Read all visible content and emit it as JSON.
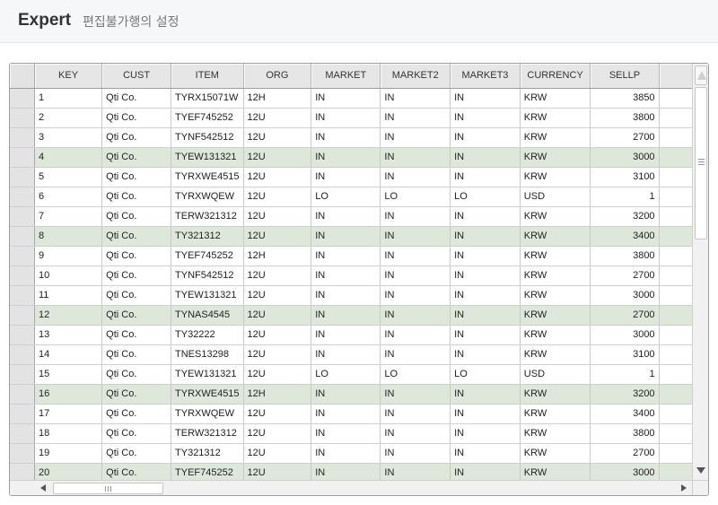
{
  "header": {
    "title": "Expert",
    "subtitle": "편집불가행의 설정"
  },
  "grid": {
    "columns": [
      {
        "key": "KEY",
        "label": "KEY"
      },
      {
        "key": "CUST",
        "label": "CUST"
      },
      {
        "key": "ITEM",
        "label": "ITEM"
      },
      {
        "key": "ORG",
        "label": "ORG"
      },
      {
        "key": "MARKET",
        "label": "MARKET"
      },
      {
        "key": "MARKET2",
        "label": "MARKET2"
      },
      {
        "key": "MARKET3",
        "label": "MARKET3"
      },
      {
        "key": "CURRENCY",
        "label": "CURRENCY"
      },
      {
        "key": "SELLP",
        "label": "SELLP"
      }
    ],
    "rows": [
      {
        "KEY": "1",
        "CUST": "Qti Co.",
        "ITEM": "TYRX15071W",
        "ORG": "12H",
        "MARKET": "IN",
        "MARKET2": "IN",
        "MARKET3": "IN",
        "CURRENCY": "KRW",
        "SELLP": "3850",
        "highlighted": false
      },
      {
        "KEY": "2",
        "CUST": "Qti Co.",
        "ITEM": "TYEF745252",
        "ORG": "12U",
        "MARKET": "IN",
        "MARKET2": "IN",
        "MARKET3": "IN",
        "CURRENCY": "KRW",
        "SELLP": "3800",
        "highlighted": false
      },
      {
        "KEY": "3",
        "CUST": "Qti Co.",
        "ITEM": "TYNF542512",
        "ORG": "12U",
        "MARKET": "IN",
        "MARKET2": "IN",
        "MARKET3": "IN",
        "CURRENCY": "KRW",
        "SELLP": "2700",
        "highlighted": false
      },
      {
        "KEY": "4",
        "CUST": "Qti Co.",
        "ITEM": "TYEW131321",
        "ORG": "12U",
        "MARKET": "IN",
        "MARKET2": "IN",
        "MARKET3": "IN",
        "CURRENCY": "KRW",
        "SELLP": "3000",
        "highlighted": true
      },
      {
        "KEY": "5",
        "CUST": "Qti Co.",
        "ITEM": "TYRXWE4515",
        "ORG": "12U",
        "MARKET": "IN",
        "MARKET2": "IN",
        "MARKET3": "IN",
        "CURRENCY": "KRW",
        "SELLP": "3100",
        "highlighted": false
      },
      {
        "KEY": "6",
        "CUST": "Qti Co.",
        "ITEM": "TYRXWQEW",
        "ORG": "12U",
        "MARKET": "LO",
        "MARKET2": "LO",
        "MARKET3": "LO",
        "CURRENCY": "USD",
        "SELLP": "1",
        "highlighted": false
      },
      {
        "KEY": "7",
        "CUST": "Qti Co.",
        "ITEM": "TERW321312",
        "ORG": "12U",
        "MARKET": "IN",
        "MARKET2": "IN",
        "MARKET3": "IN",
        "CURRENCY": "KRW",
        "SELLP": "3200",
        "highlighted": false
      },
      {
        "KEY": "8",
        "CUST": "Qti Co.",
        "ITEM": "TY321312",
        "ORG": "12U",
        "MARKET": "IN",
        "MARKET2": "IN",
        "MARKET3": "IN",
        "CURRENCY": "KRW",
        "SELLP": "3400",
        "highlighted": true
      },
      {
        "KEY": "9",
        "CUST": "Qti Co.",
        "ITEM": "TYEF745252",
        "ORG": "12H",
        "MARKET": "IN",
        "MARKET2": "IN",
        "MARKET3": "IN",
        "CURRENCY": "KRW",
        "SELLP": "3800",
        "highlighted": false
      },
      {
        "KEY": "10",
        "CUST": "Qti Co.",
        "ITEM": "TYNF542512",
        "ORG": "12U",
        "MARKET": "IN",
        "MARKET2": "IN",
        "MARKET3": "IN",
        "CURRENCY": "KRW",
        "SELLP": "2700",
        "highlighted": false
      },
      {
        "KEY": "11",
        "CUST": "Qti Co.",
        "ITEM": "TYEW131321",
        "ORG": "12U",
        "MARKET": "IN",
        "MARKET2": "IN",
        "MARKET3": "IN",
        "CURRENCY": "KRW",
        "SELLP": "3000",
        "highlighted": false
      },
      {
        "KEY": "12",
        "CUST": "Qti Co.",
        "ITEM": "TYNAS4545",
        "ORG": "12U",
        "MARKET": "IN",
        "MARKET2": "IN",
        "MARKET3": "IN",
        "CURRENCY": "KRW",
        "SELLP": "2700",
        "highlighted": true
      },
      {
        "KEY": "13",
        "CUST": "Qti Co.",
        "ITEM": "TY32222",
        "ORG": "12U",
        "MARKET": "IN",
        "MARKET2": "IN",
        "MARKET3": "IN",
        "CURRENCY": "KRW",
        "SELLP": "3000",
        "highlighted": false
      },
      {
        "KEY": "14",
        "CUST": "Qti Co.",
        "ITEM": "TNES13298",
        "ORG": "12U",
        "MARKET": "IN",
        "MARKET2": "IN",
        "MARKET3": "IN",
        "CURRENCY": "KRW",
        "SELLP": "3100",
        "highlighted": false
      },
      {
        "KEY": "15",
        "CUST": "Qti Co.",
        "ITEM": "TYEW131321",
        "ORG": "12U",
        "MARKET": "LO",
        "MARKET2": "LO",
        "MARKET3": "LO",
        "CURRENCY": "USD",
        "SELLP": "1",
        "highlighted": false
      },
      {
        "KEY": "16",
        "CUST": "Qti Co.",
        "ITEM": "TYRXWE4515",
        "ORG": "12H",
        "MARKET": "IN",
        "MARKET2": "IN",
        "MARKET3": "IN",
        "CURRENCY": "KRW",
        "SELLP": "3200",
        "highlighted": true
      },
      {
        "KEY": "17",
        "CUST": "Qti Co.",
        "ITEM": "TYRXWQEW",
        "ORG": "12U",
        "MARKET": "IN",
        "MARKET2": "IN",
        "MARKET3": "IN",
        "CURRENCY": "KRW",
        "SELLP": "3400",
        "highlighted": false
      },
      {
        "KEY": "18",
        "CUST": "Qti Co.",
        "ITEM": "TERW321312",
        "ORG": "12U",
        "MARKET": "IN",
        "MARKET2": "IN",
        "MARKET3": "IN",
        "CURRENCY": "KRW",
        "SELLP": "3800",
        "highlighted": false
      },
      {
        "KEY": "19",
        "CUST": "Qti Co.",
        "ITEM": "TY321312",
        "ORG": "12U",
        "MARKET": "IN",
        "MARKET2": "IN",
        "MARKET3": "IN",
        "CURRENCY": "KRW",
        "SELLP": "2700",
        "highlighted": false
      },
      {
        "KEY": "20",
        "CUST": "Qti Co.",
        "ITEM": "TYEF745252",
        "ORG": "12U",
        "MARKET": "IN",
        "MARKET2": "IN",
        "MARKET3": "IN",
        "CURRENCY": "KRW",
        "SELLP": "3000",
        "highlighted": true
      }
    ],
    "highlight_color": "#dde8db",
    "icons": {
      "scroll_up": "triangle-up-icon",
      "scroll_down": "triangle-down-icon",
      "scroll_left": "triangle-left-icon",
      "scroll_right": "triangle-right-icon",
      "grip": "grip-lines-icon"
    }
  }
}
